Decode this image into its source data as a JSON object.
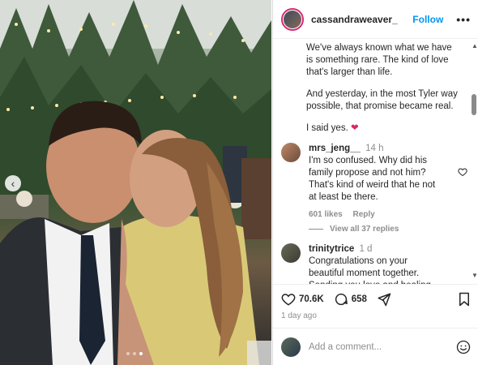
{
  "post": {
    "username": "cassandraweaver_",
    "follow_label": "Follow",
    "more_label": "•••",
    "caption": [
      "We've always known what we have is something rare. The kind of love that's larger than life.",
      "And yesterday, in the most Tyler way possible, that promise became real.",
      "I said yes."
    ],
    "caption_emoji": "❤",
    "likes": "70.6K",
    "comments_count": "658",
    "time_ago": "1 day ago",
    "carousel": {
      "slides": 3,
      "active_slide": 3
    }
  },
  "comments": [
    {
      "user": "mrs_jeng__",
      "time": "14 h",
      "text": "I'm so confused. Why did his family propose and not him? That's kind of weird that he not at least be there.",
      "likes": "601 likes",
      "reply_label": "Reply",
      "view_replies": "View all 37 replies"
    },
    {
      "user": "trinitytrice",
      "time": "1 d",
      "text": "Congratulations on your beautiful moment together. Sending you love and healing from the Port"
    }
  ],
  "add_comment": {
    "placeholder": "Add a comment..."
  },
  "colors": {
    "accent": "#0095f6",
    "heart": "#e0245e"
  }
}
